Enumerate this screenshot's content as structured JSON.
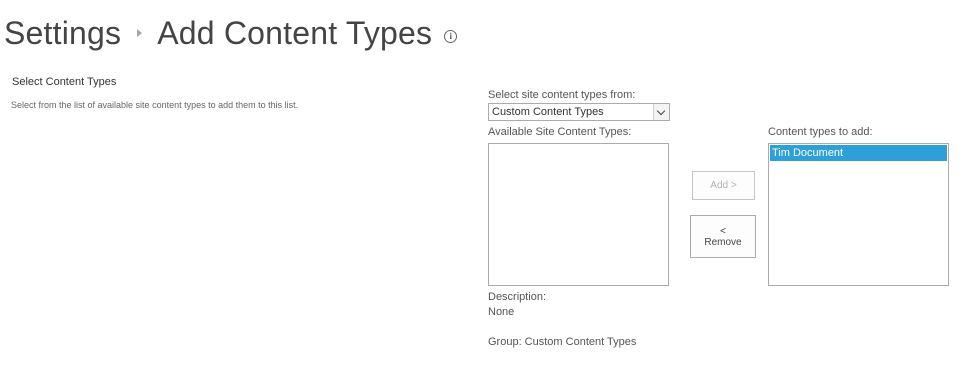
{
  "breadcrumb": {
    "root": "Settings",
    "current": "Add Content Types",
    "info_icon": "info-icon"
  },
  "section": {
    "title": "Select Content Types",
    "description": "Select from the list of available site content types to add them to this list."
  },
  "form": {
    "select_from_label": "Select site content types from:",
    "select_from_value": "Custom Content Types",
    "available_label": "Available Site Content Types:",
    "available_items": [],
    "to_add_label": "Content types to add:",
    "to_add_items": [
      "Tim Document"
    ],
    "add_button": "Add >",
    "remove_button_top": "<",
    "remove_button_bottom": "Remove",
    "description_label": "Description:",
    "description_value": "None",
    "group_text": "Group: Custom Content Types"
  },
  "colors": {
    "selected_item_bg": "#2d9fd9",
    "text": "#444444"
  }
}
